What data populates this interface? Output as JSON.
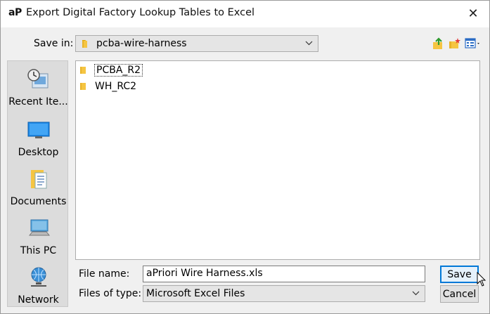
{
  "window": {
    "app_logo": "aP",
    "title": "Export Digital Factory Lookup Tables to Excel",
    "close_glyph": "✕"
  },
  "save_in": {
    "label": "Save in:",
    "value": "pcba-wire-harness"
  },
  "toolbar": {
    "icons": [
      "up-one-level-icon",
      "new-folder-icon",
      "view-menu-icon"
    ]
  },
  "places": [
    {
      "label": "Recent Ite...",
      "icon": "recent-items-icon"
    },
    {
      "label": "Desktop",
      "icon": "desktop-icon"
    },
    {
      "label": "Documents",
      "icon": "documents-icon"
    },
    {
      "label": "This PC",
      "icon": "this-pc-icon"
    },
    {
      "label": "Network",
      "icon": "network-icon"
    }
  ],
  "files": [
    {
      "name": "PCBA_R2",
      "type": "folder",
      "selected": true
    },
    {
      "name": "WH_RC2",
      "type": "folder",
      "selected": false
    }
  ],
  "file_name": {
    "label": "File name:",
    "value": "aPriori Wire Harness.xls"
  },
  "file_type": {
    "label": "Files of type:",
    "value": "Microsoft Excel Files"
  },
  "buttons": {
    "save": "Save",
    "cancel": "Cancel"
  },
  "colors": {
    "accent": "#0078d7",
    "folder": "#f5c542",
    "dialog_bg": "#f0f0f0"
  }
}
